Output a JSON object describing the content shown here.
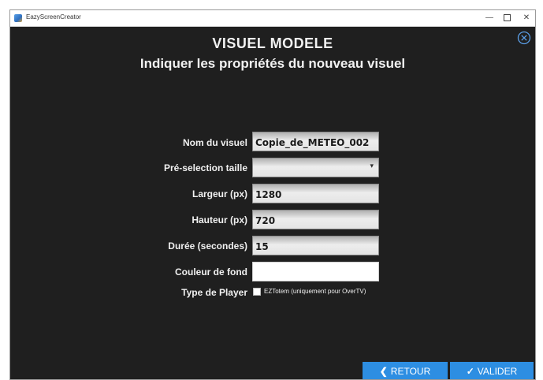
{
  "window": {
    "title": "EazyScreenCreator",
    "minimize_glyph": "—",
    "close_glyph": "✕"
  },
  "header": {
    "title": "VISUEL MODELE",
    "subtitle": "Indiquer les propriétés du nouveau visuel"
  },
  "form": {
    "nom_label": "Nom du visuel",
    "nom_value": "Copie_de_METEO_002",
    "preselection_label": "Pré-selection taille",
    "preselection_value": "",
    "largeur_label": "Largeur (px)",
    "largeur_value": "1280",
    "hauteur_label": "Hauteur (px)",
    "hauteur_value": "720",
    "duree_label": "Durée (secondes)",
    "duree_value": "15",
    "couleur_label": "Couleur de fond",
    "couleur_value": "#ffffff",
    "player_label": "Type de Player",
    "player_option": "EZTotem  (uniquement pour OverTV)",
    "player_checked": false
  },
  "buttons": {
    "retour_icon": "❮",
    "retour": "RETOUR",
    "valider_icon": "✓",
    "valider": "VALIDER"
  },
  "colors": {
    "background": "#1f1f1f",
    "accent": "#2d8ee2"
  },
  "icons": {
    "app": "app-icon",
    "close": "close-circle-icon",
    "dropdown": "chevron-down-icon",
    "back": "chevron-left-icon",
    "check": "check-icon"
  }
}
